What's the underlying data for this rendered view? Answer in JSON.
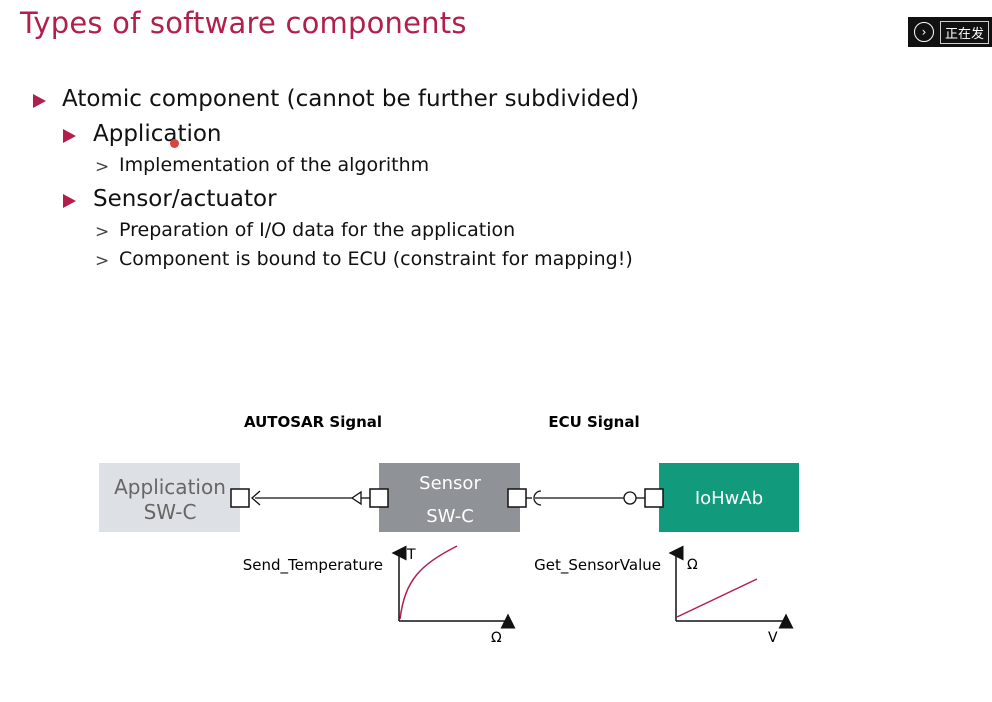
{
  "title": "Types of software components",
  "overlay": {
    "label": "正在发",
    "icon": "chevron-right-icon"
  },
  "bullets": {
    "atomic": "Atomic component (cannot be further subdivided)",
    "application": "Application",
    "application_sub": "Implementation of the algorithm",
    "sensor": "Sensor/actuator",
    "sensor_sub1": "Preparation of I/O data for the application",
    "sensor_sub2": "Component is bound to ECU (constraint for mapping!)",
    "marker": ">"
  },
  "diagram": {
    "autosar_signal": "AUTOSAR Signal",
    "ecu_signal": "ECU Signal",
    "application_box": [
      "Application",
      "SW-C"
    ],
    "sensor_box": [
      "Sensor",
      "SW-C"
    ],
    "iohwab_box": "IoHwAb",
    "send_temperature": "Send_Temperature",
    "get_sensorvalue": "Get_SensorValue",
    "graph1_y": "T",
    "graph1_x": "Ω",
    "graph2_y": "Ω",
    "graph2_x": "V"
  },
  "colors": {
    "accent": "#b21f4a",
    "application_box": "#dde0e4",
    "sensor_box": "#8f9296",
    "iohwab_box": "#129a7d"
  }
}
